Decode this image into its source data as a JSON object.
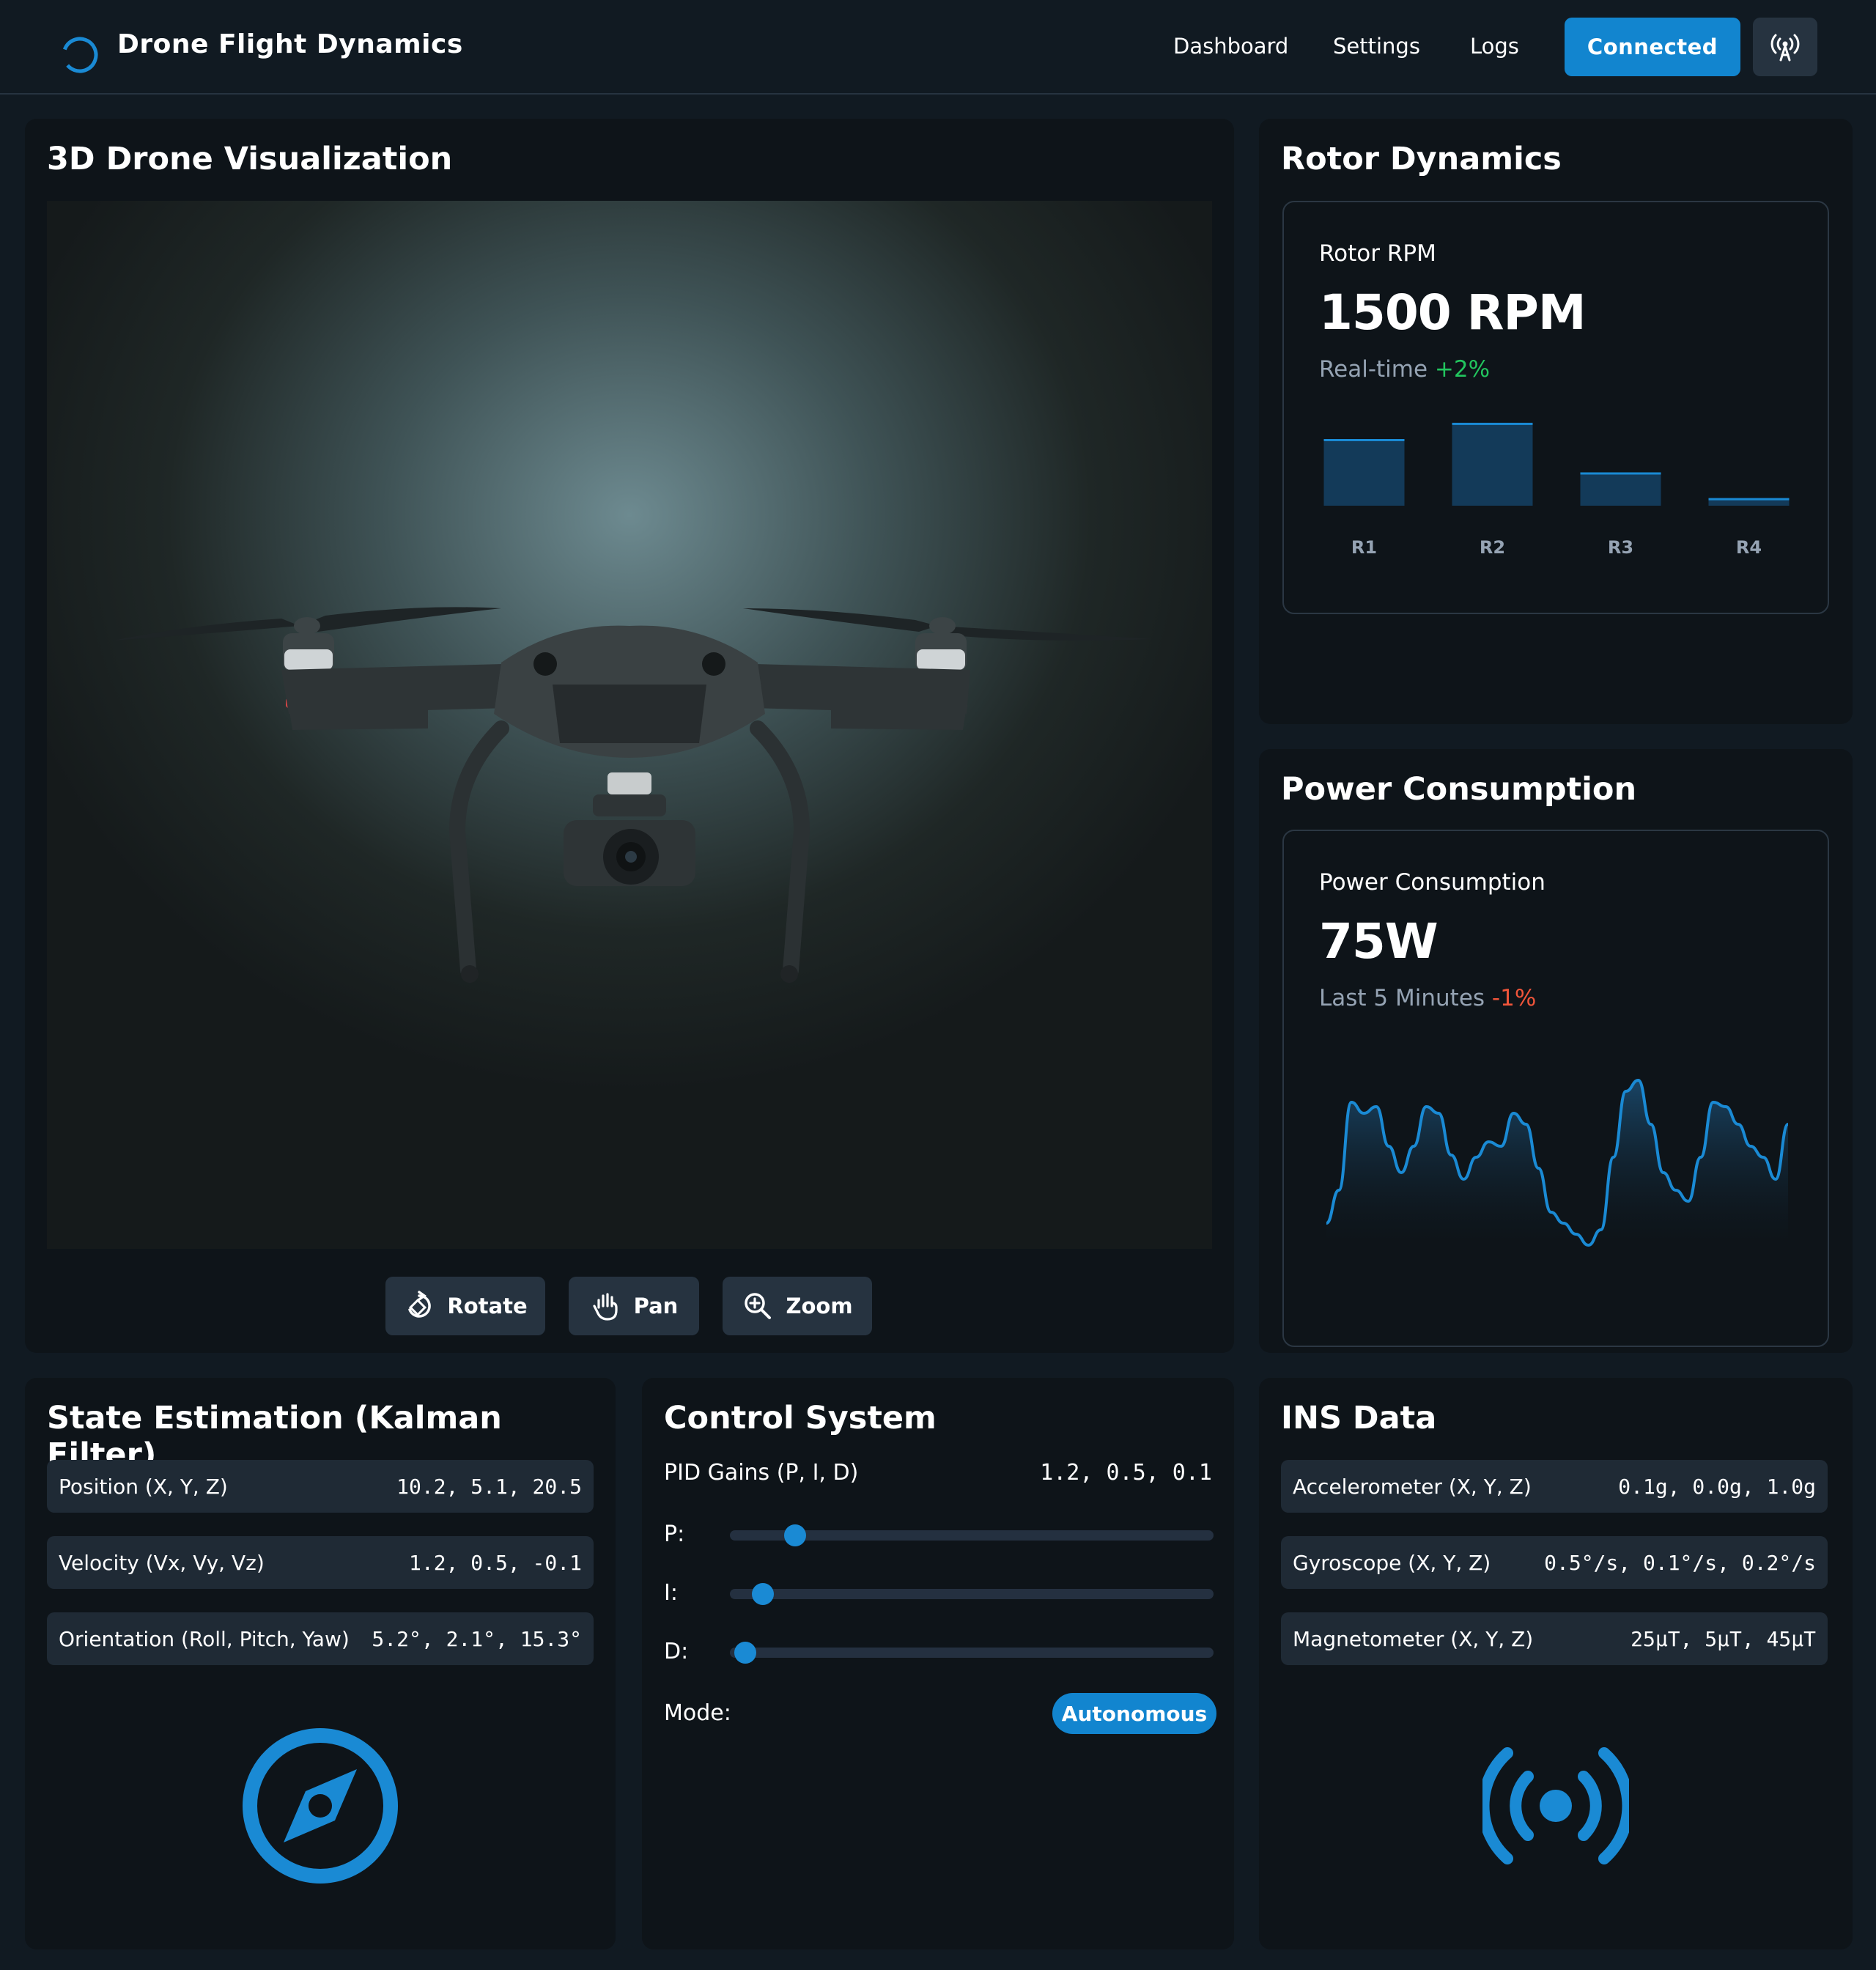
{
  "header": {
    "app_title": "Drone Flight Dynamics",
    "nav": [
      "Dashboard",
      "Settings",
      "Logs"
    ],
    "status_button": "Connected",
    "antenna_icon": "antenna-icon",
    "logo_icon": "spinner-logo-icon"
  },
  "viz": {
    "title": "3D Drone Visualization",
    "tools": [
      {
        "label": "Rotate",
        "icon": "rotate-icon"
      },
      {
        "label": "Pan",
        "icon": "hand-icon"
      },
      {
        "label": "Zoom",
        "icon": "zoom-icon"
      }
    ]
  },
  "rotor": {
    "title": "Rotor Dynamics",
    "card_label": "Rotor RPM",
    "value": "1500 RPM",
    "sub_label": "Real-time",
    "delta": "+2%"
  },
  "power": {
    "title": "Power Consumption",
    "card_label": "Power Consumption",
    "value": "75W",
    "sub_label": "Last 5 Minutes",
    "delta": "-1%"
  },
  "state": {
    "title": "State Estimation (Kalman Filter)",
    "rows": [
      {
        "label": "Position (X, Y, Z)",
        "value": "10.2, 5.1, 20.5"
      },
      {
        "label": "Velocity (Vx, Vy, Vz)",
        "value": "1.2, 0.5, -0.1"
      },
      {
        "label": "Orientation (Roll, Pitch, Yaw)",
        "value": "5.2°, 2.1°, 15.3°"
      }
    ],
    "icon": "compass-icon"
  },
  "control": {
    "title": "Control System",
    "pid_label": "PID Gains (P, I, D)",
    "pid_value": "1.2, 0.5, 0.1",
    "sliders": [
      {
        "label": "P:",
        "level": 0.135
      },
      {
        "label": "I:",
        "level": 0.068
      },
      {
        "label": "D:",
        "level": 0.032
      }
    ],
    "mode_label": "Mode:",
    "mode_value": "Autonomous"
  },
  "ins": {
    "title": "INS Data",
    "rows": [
      {
        "label": "Accelerometer (X, Y, Z)",
        "value": "0.1g, 0.0g, 1.0g"
      },
      {
        "label": "Gyroscope (X, Y, Z)",
        "value": "0.5°/s, 0.1°/s, 0.2°/s"
      },
      {
        "label": "Magnetometer (X, Y, Z)",
        "value": "25μT, 5μT, 45μT"
      }
    ],
    "icon": "broadcast-icon"
  },
  "colors": {
    "accent": "#1285cf",
    "positive": "#22c55e",
    "negative": "#f0553a",
    "bar_fill": "#133a59",
    "bar_top": "#1a8ad4"
  },
  "chart_data": [
    {
      "type": "bar",
      "categories": [
        "R1",
        "R2",
        "R3",
        "R4"
      ],
      "values": [
        70,
        87,
        35,
        8
      ],
      "title": "Rotor RPM",
      "ylim": [
        0,
        100
      ]
    },
    {
      "type": "area",
      "title": "Power Consumption",
      "x": [
        0,
        1,
        2,
        3,
        4,
        5,
        6,
        7,
        8,
        9,
        10,
        11,
        12,
        13,
        14,
        15,
        16,
        17,
        18,
        19,
        20,
        21,
        22,
        23,
        24,
        25,
        26,
        27,
        28,
        29,
        30,
        31,
        32,
        33,
        34,
        35,
        36,
        37
      ],
      "values": [
        25,
        40,
        80,
        75,
        78,
        60,
        48,
        60,
        78,
        75,
        56,
        45,
        55,
        62,
        60,
        75,
        70,
        50,
        30,
        25,
        20,
        15,
        22,
        55,
        85,
        90,
        70,
        48,
        40,
        35,
        55,
        80,
        78,
        70,
        60,
        55,
        45,
        70
      ],
      "ylim": [
        0,
        100
      ]
    }
  ]
}
